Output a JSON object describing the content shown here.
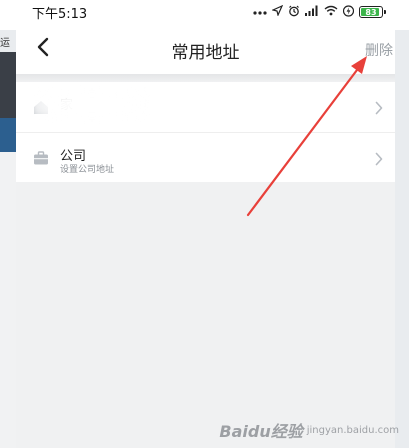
{
  "status_bar": {
    "time": "下午5:13",
    "icons": [
      "more-dots-icon",
      "location-icon",
      "alarm-icon",
      "signal-icon",
      "wifi-icon",
      "bolt-icon",
      "battery-icon"
    ],
    "battery_level": "83"
  },
  "nav": {
    "back_icon": "chevron-left-icon",
    "title": "常用地址",
    "action_label": "删除"
  },
  "addresses": [
    {
      "icon": "home-icon",
      "title": "家",
      "subtitle": ""
    },
    {
      "icon": "briefcase-icon",
      "title": "公司",
      "subtitle": "设置公司地址"
    }
  ],
  "background_app": {
    "fragment_text": "运"
  },
  "watermark": {
    "text": "Baidu经验",
    "sub": "jingyan.baidu.com"
  },
  "colors": {
    "annotation_arrow": "#e8403a",
    "battery_fill": "#3bb54a",
    "action_text": "#9aa0a6"
  }
}
